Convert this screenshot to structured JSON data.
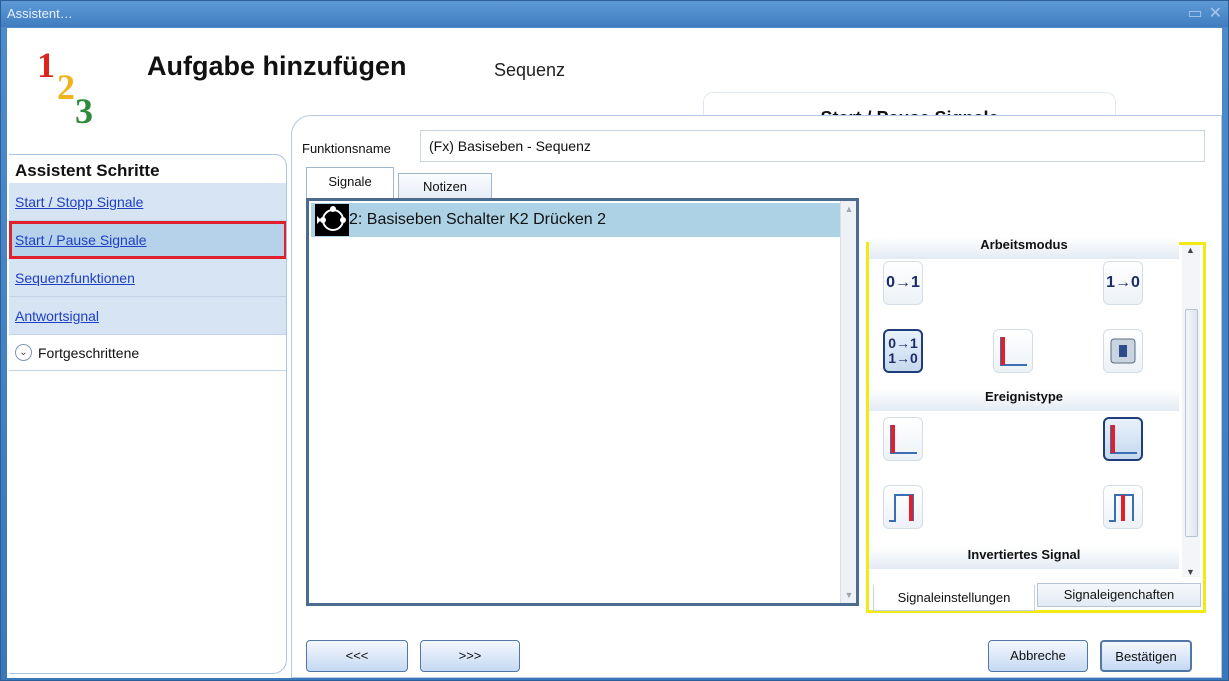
{
  "window": {
    "title": "Assistent…",
    "restore_icon": "restore-icon",
    "close_icon": "close-icon"
  },
  "logo": {
    "d1": "1",
    "d2": "2",
    "d3": "3"
  },
  "header": {
    "title": "Aufgabe hinzufügen",
    "subtitle": "Sequenz",
    "step_tab": "Start / Pause Signale"
  },
  "steps": {
    "heading": "Assistent Schritte",
    "items": [
      {
        "label": "Start / Stopp Signale",
        "active": false
      },
      {
        "label": "Start / Pause Signale",
        "active": true
      },
      {
        "label": "Sequenzfunktionen",
        "active": false
      },
      {
        "label": "Antwortsignal",
        "active": false
      }
    ],
    "advanced": "Fortgeschrittene"
  },
  "form": {
    "label": "Funktionsname",
    "value": "(Fx) Basiseben - Sequenz"
  },
  "tabs": {
    "signale": "Signale",
    "notizen": "Notizen"
  },
  "signals": {
    "items": [
      {
        "label": "2: Basiseben Schalter K2 Drücken 2"
      }
    ]
  },
  "settings": {
    "sections": {
      "arbeitsmodus": "Arbeitsmodus",
      "ereignistype": "Ereignistype",
      "invertiert": "Invertiertes Signal"
    },
    "mode_labels": {
      "rise": "0→1",
      "fall": "1→0",
      "both_top": "0→1",
      "both_bottom": "1→0"
    },
    "tabs": {
      "einstellungen": "Signaleinstellungen",
      "eigenschaften": "Signaleigenchaften"
    },
    "colors": {
      "highlight": "#f2ea16",
      "signal_red": "#e0202a",
      "signal_blue": "#3a6fb5"
    }
  },
  "buttons": {
    "prev": "<<<",
    "next": ">>>",
    "cancel": "Abbreche",
    "confirm": "Bestätigen"
  }
}
